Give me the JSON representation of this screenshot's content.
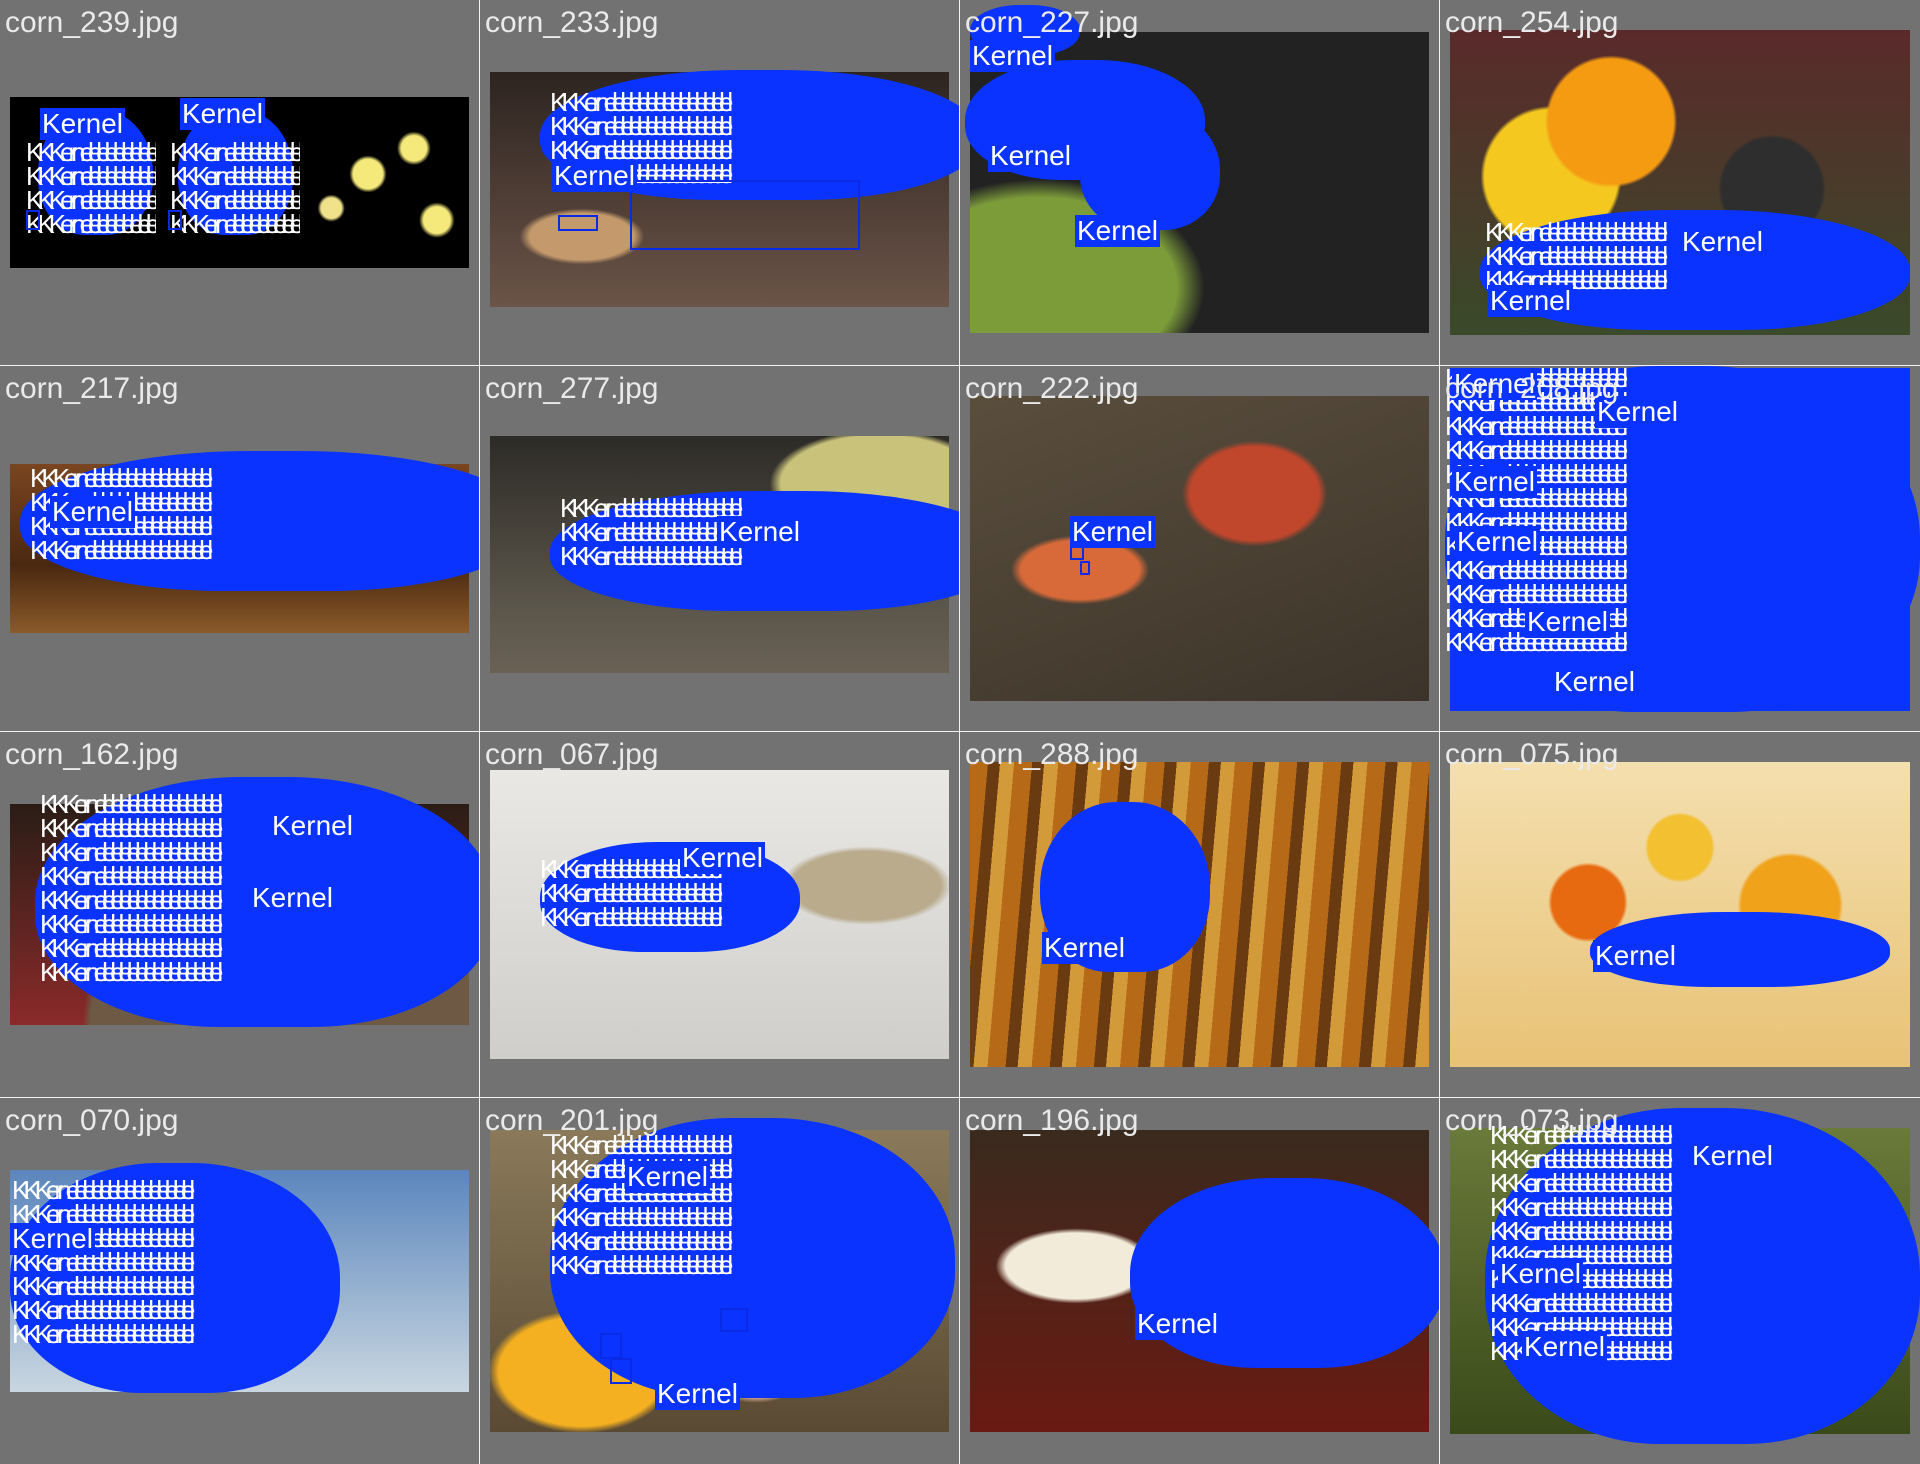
{
  "label": "Kernel",
  "label_color": "#0a33ff",
  "tiles": [
    {
      "filename": "corn_239.jpg",
      "bg": "#000000",
      "scene": "flowers-on-black"
    },
    {
      "filename": "corn_233.jpg",
      "bg": "#4a3a34",
      "scene": "cob-on-soil"
    },
    {
      "filename": "corn_227.jpg",
      "bg": "#1e1e1e",
      "scene": "husk-dark"
    },
    {
      "filename": "corn_254.jpg",
      "bg": "#5b4a2f",
      "scene": "squash-market"
    },
    {
      "filename": "corn_217.jpg",
      "bg": "#6b3e1c",
      "scene": "cob-on-wood"
    },
    {
      "filename": "corn_277.jpg",
      "bg": "#3a3834",
      "scene": "cob-on-husk"
    },
    {
      "filename": "corn_222.jpg",
      "bg": "#4d4235",
      "scene": "red-cobs-field"
    },
    {
      "filename": "corn_208.jpg",
      "bg": "#7a5a2a",
      "scene": "full-cover"
    },
    {
      "filename": "corn_162.jpg",
      "bg": "#5a3f2a",
      "scene": "basket"
    },
    {
      "filename": "corn_067.jpg",
      "bg": "#d7d6d3",
      "scene": "dry-husk-white"
    },
    {
      "filename": "corn_288.jpg",
      "bg": "#8a5a1e",
      "scene": "dry-field"
    },
    {
      "filename": "corn_075.jpg",
      "bg": "#f0d9a8",
      "scene": "painted-pumpkins"
    },
    {
      "filename": "corn_070.jpg",
      "bg": "#a5bdd5",
      "scene": "sky"
    },
    {
      "filename": "corn_201.jpg",
      "bg": "#7b6a4c",
      "scene": "grains-burlap"
    },
    {
      "filename": "corn_196.jpg",
      "bg": "#4a1e14",
      "scene": "chilies"
    },
    {
      "filename": "corn_073.jpg",
      "bg": "#4a5a2a",
      "scene": "grass"
    }
  ]
}
